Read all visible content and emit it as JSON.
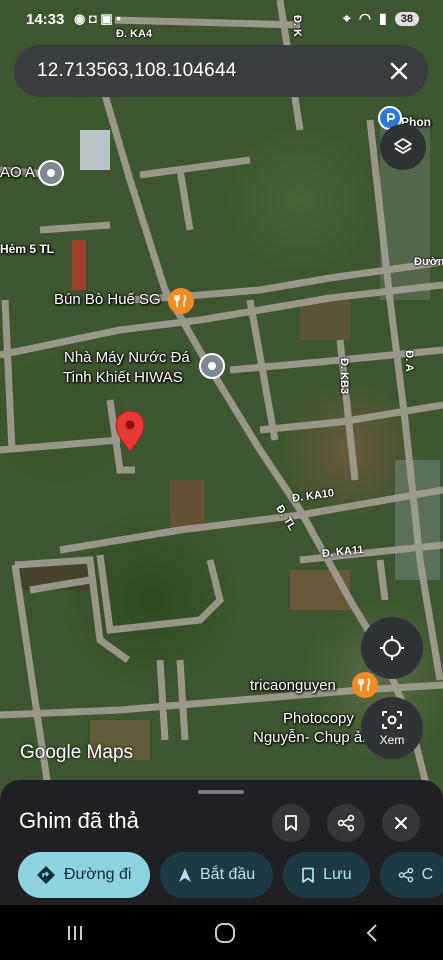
{
  "status_bar": {
    "time": "14:33",
    "battery": "38"
  },
  "search": {
    "value": "12.713563,108.104644"
  },
  "map": {
    "labels": {
      "ka4": "Đ. KA4",
      "ao_a": "AO A",
      "hem5": "Hẻm 5 TL",
      "bun_bo": "Bún Bò Huế SG",
      "nha_may_line1": "Nhà Máy Nước Đá",
      "nha_may_line2": "Tinh Khiết HIWAS",
      "kb3": "Đ. KB3",
      "ka10": "Đ. KA10",
      "ka11": "Đ. KA11",
      "tl": "Đ. TL",
      "da": "Đ. A",
      "tricao": "tricaonguyen",
      "photocopy_line1": "Photocopy",
      "photocopy_line2": "Nguyễn- Chụp ảnh",
      "phon": "Phon",
      "duong": "Đườn",
      "dk": "Đ. K"
    },
    "view_button_label": "Xem",
    "logo": "Google Maps"
  },
  "sheet": {
    "title": "Ghim đã thả",
    "chips": {
      "directions": "Đường đi",
      "start": "Bắt đầu",
      "save": "Lưu",
      "share": "C"
    }
  },
  "colors": {
    "chip_primary": "#8fd2e0",
    "chip_dark": "#1d3a44",
    "pin_red": "#e53935",
    "poi_orange": "#f28b21",
    "sheet_bg": "#1f2023"
  }
}
